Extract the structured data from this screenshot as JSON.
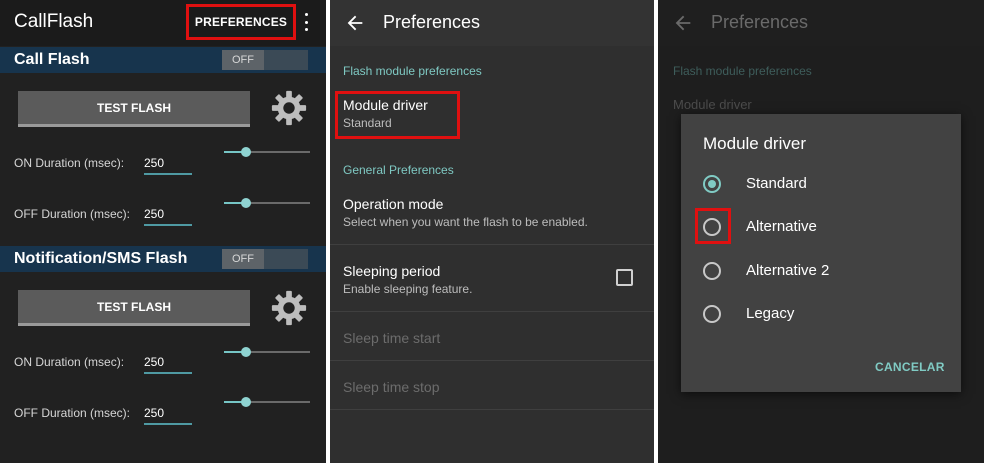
{
  "screen1": {
    "app_title": "CallFlash",
    "preferences_button": "PREFERENCES",
    "call_flash": {
      "label": "Call Flash",
      "toggle": "OFF",
      "test_button": "TEST FLASH",
      "on_duration": {
        "label": "ON Duration (msec):",
        "value": "250",
        "slider_level": 0.25
      },
      "off_duration": {
        "label": "OFF Duration (msec):",
        "value": "250",
        "slider_level": 0.25
      }
    },
    "sms_flash": {
      "label": "Notification/SMS Flash",
      "toggle": "OFF",
      "test_button": "TEST FLASH",
      "on_duration": {
        "label": "ON Duration (msec):",
        "value": "250",
        "slider_level": 0.25
      },
      "off_duration": {
        "label": "OFF Duration (msec):",
        "value": "250",
        "slider_level": 0.25
      }
    }
  },
  "screen2": {
    "title": "Preferences",
    "flash_module_category": "Flash module preferences",
    "module_driver": {
      "title": "Module driver",
      "summary": "Standard"
    },
    "general_category": "General Preferences",
    "operation_mode": {
      "title": "Operation mode",
      "summary": "Select when you want the flash to be enabled."
    },
    "sleeping_period": {
      "title": "Sleeping period",
      "summary": "Enable sleeping feature.",
      "checked": false
    },
    "sleep_time_start": "Sleep time start",
    "sleep_time_stop": "Sleep time stop"
  },
  "screen3": {
    "title": "Preferences",
    "bg_category": "Flash module preferences",
    "bg_module_driver": "Module driver",
    "dialog": {
      "title": "Module driver",
      "options": [
        "Standard",
        "Alternative",
        "Alternative 2",
        "Legacy"
      ],
      "selected": "Standard",
      "cancel": "CANCELAR"
    }
  },
  "colors": {
    "accent": "#80cbc4",
    "highlight": "#e01010",
    "section_header": "#17344d"
  }
}
